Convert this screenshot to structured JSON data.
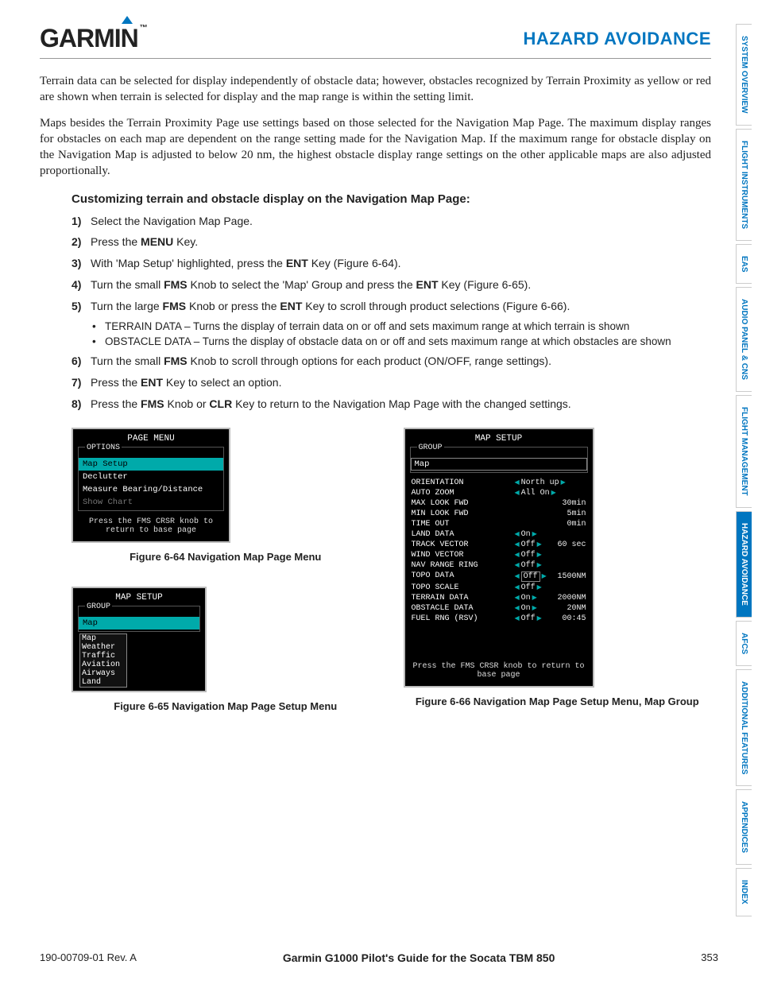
{
  "header": {
    "logo": "GARMIN",
    "section": "HAZARD AVOIDANCE"
  },
  "para1": "Terrain data can be selected for display independently of obstacle data; however, obstacles recognized by Terrain Proximity as yellow or red are shown when terrain is selected for display and the map range is within the setting limit.",
  "para2": "Maps besides the Terrain Proximity Page use settings based on those selected for the Navigation Map Page. The maximum display ranges for obstacles on each map are dependent on the range setting made for the Navigation Map.  If the maximum range for obstacle display on the Navigation Map is adjusted to below 20 nm, the highest obstacle display range settings on the other applicable maps are also adjusted proportionally.",
  "proc_title": "Customizing terrain and obstacle display on the Navigation Map Page:",
  "steps": {
    "s1": "Select the Navigation Map Page.",
    "s2a": "Press the ",
    "s2b": "MENU",
    "s2c": " Key.",
    "s3a": "With 'Map Setup' highlighted, press the ",
    "s3b": "ENT",
    "s3c": " Key (Figure 6-64).",
    "s4a": "Turn the small ",
    "s4b": "FMS",
    "s4c": " Knob to select the 'Map' Group and press the ",
    "s4d": "ENT",
    "s4e": " Key (Figure 6-65).",
    "s5a": "Turn the large ",
    "s5b": "FMS",
    "s5c": " Knob or press the ",
    "s5d": "ENT",
    "s5e": " Key to scroll through product selections (Figure 6-66).",
    "b1": "TERRAIN DATA – Turns the display of terrain data on or off and sets maximum range at which terrain is shown",
    "b2": "OBSTACLE DATA – Turns the display of obstacle data on or off and sets maximum range at which obstacles are shown",
    "s6a": "Turn the small ",
    "s6b": "FMS",
    "s6c": " Knob to scroll through options for each product (ON/OFF, range settings).",
    "s7a": "Press the ",
    "s7b": "ENT",
    "s7c": " Key to select an option.",
    "s8a": "Press the ",
    "s8b": "FMS",
    "s8c": " Knob or ",
    "s8d": "CLR",
    "s8e": " Key to return to the Navigation Map Page with the changed settings."
  },
  "fig64": {
    "title": "PAGE MENU",
    "options_label": "OPTIONS",
    "items": [
      "Map Setup",
      "Declutter",
      "Measure Bearing/Distance",
      "Show Chart"
    ],
    "hint": "Press the FMS CRSR knob to return to base page",
    "caption": "Figure 6-64  Navigation Map Page Menu"
  },
  "fig65": {
    "title": "MAP SETUP",
    "group_label": "GROUP",
    "selected": "Map",
    "popup": [
      "Map",
      "Weather",
      "Traffic",
      "Aviation",
      "Airways",
      "Land"
    ],
    "caption": "Figure 6-65  Navigation Map Page Setup Menu"
  },
  "fig66": {
    "title": "MAP SETUP",
    "group_label": "GROUP",
    "selected": "Map",
    "rows": [
      {
        "lab": "ORIENTATION",
        "val": "North up",
        "right": ""
      },
      {
        "lab": "AUTO ZOOM",
        "val": "All On",
        "right": ""
      },
      {
        "lab": "MAX LOOK FWD",
        "val": "",
        "right": "30min"
      },
      {
        "lab": "MIN LOOK FWD",
        "val": "",
        "right": "5min"
      },
      {
        "lab": "TIME OUT",
        "val": "",
        "right": "0min"
      },
      {
        "lab": "LAND DATA",
        "val": "On",
        "right": ""
      },
      {
        "lab": "TRACK VECTOR",
        "val": "Off",
        "right": "60 sec"
      },
      {
        "lab": "WIND VECTOR",
        "val": "Off",
        "right": ""
      },
      {
        "lab": "NAV RANGE RING",
        "val": "Off",
        "right": ""
      },
      {
        "lab": "TOPO DATA",
        "val": "Off",
        "right": "1500NM",
        "box": true
      },
      {
        "lab": "TOPO SCALE",
        "val": "Off",
        "right": ""
      },
      {
        "lab": "TERRAIN DATA",
        "val": "On",
        "right": "2000NM"
      },
      {
        "lab": "OBSTACLE DATA",
        "val": "On",
        "right": "20NM"
      },
      {
        "lab": "FUEL RNG (RSV)",
        "val": "Off",
        "right": "00:45"
      }
    ],
    "hint": "Press the FMS CRSR knob to return to base page",
    "caption": "Figure 6-66  Navigation Map Page Setup Menu, Map Group"
  },
  "tabs": [
    "SYSTEM OVERVIEW",
    "FLIGHT INSTRUMENTS",
    "EAS",
    "AUDIO PANEL & CNS",
    "FLIGHT MANAGEMENT",
    "HAZARD AVOIDANCE",
    "AFCS",
    "ADDITIONAL FEATURES",
    "APPENDICES",
    "INDEX"
  ],
  "footer": {
    "left": "190-00709-01  Rev. A",
    "mid": "Garmin G1000 Pilot's Guide for the Socata TBM 850",
    "right": "353"
  }
}
